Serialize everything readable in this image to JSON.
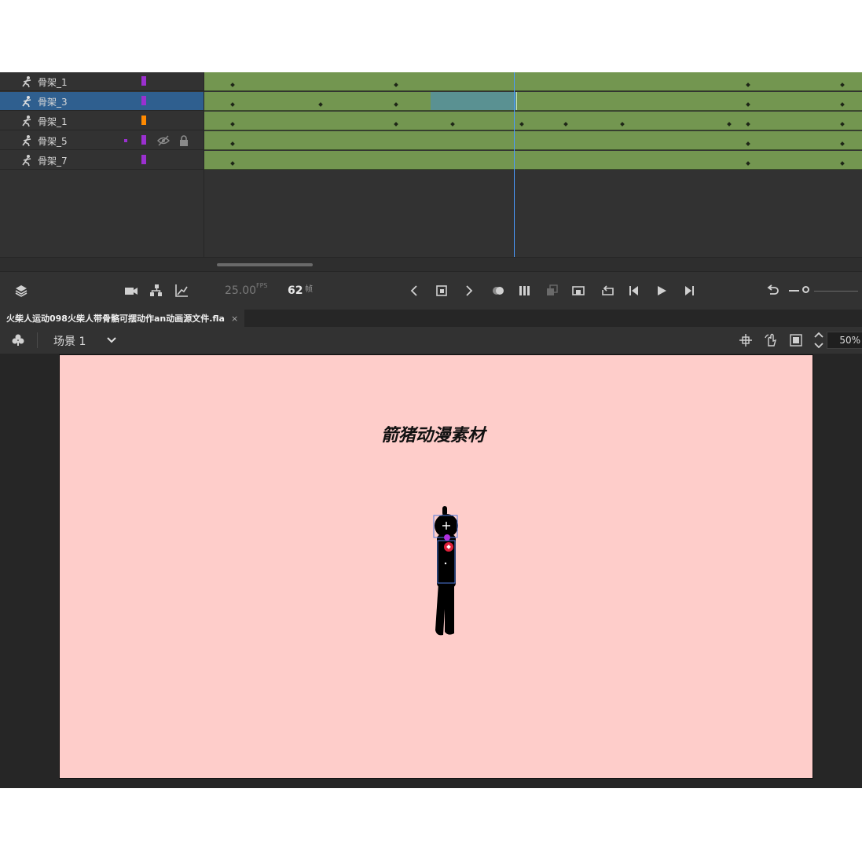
{
  "timeline": {
    "layers": [
      {
        "name": "骨架_1",
        "color": "#9b30d0",
        "selected": false
      },
      {
        "name": "骨架_3",
        "color": "#9b30d0",
        "selected": true
      },
      {
        "name": "骨架_1",
        "color": "#ff8a00",
        "selected": false
      },
      {
        "name": "骨架_5",
        "color": "#9b30d0",
        "selected": false,
        "hidden": true,
        "locked": true
      },
      {
        "name": "骨架_7",
        "color": "#9b30d0",
        "selected": false
      }
    ],
    "frame_color": "#739650",
    "selection_color": "#5a9192",
    "playhead_color": "#4a9aff"
  },
  "toolbar": {
    "fps": "25.00",
    "fps_unit": "FPS",
    "current_frame": "62",
    "frame_unit": "帧"
  },
  "document": {
    "tab_title": "火柴人运动098火柴人带骨骼可摆动作an动画源文件.fla",
    "tab_close": "×"
  },
  "edit_bar": {
    "scene_label": "场景 1",
    "zoom": "50%"
  },
  "stage": {
    "background": "#fecdca",
    "title_text": "箭猪动漫素材"
  }
}
